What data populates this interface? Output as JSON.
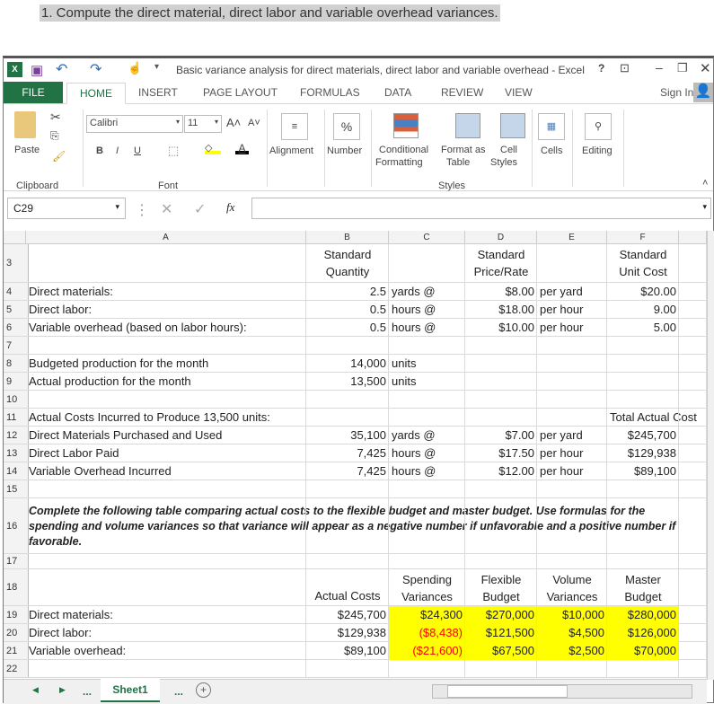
{
  "question": "1. Compute the direct material, direct labor and variable overhead variances.",
  "window": {
    "title": "Basic variance analysis for direct materials, direct labor and variable overhead - Excel",
    "help": "?",
    "sign_in": "Sign In"
  },
  "tabs": [
    "FILE",
    "HOME",
    "INSERT",
    "PAGE LAYOUT",
    "FORMULAS",
    "DATA",
    "REVIEW",
    "VIEW"
  ],
  "ribbon": {
    "paste": "Paste",
    "font_name": "Calibri",
    "font_size": "11",
    "bold": "B",
    "italic": "I",
    "underline": "U",
    "alignment": "Alignment",
    "number": "Number",
    "percent": "%",
    "conditional": "Conditional",
    "formatting": "Formatting",
    "format_as": "Format as",
    "table": "Table",
    "cell": "Cell",
    "styles_btn": "Styles",
    "cells": "Cells",
    "editing": "Editing",
    "groups": {
      "clipboard": "Clipboard",
      "font": "Font",
      "styles": "Styles"
    }
  },
  "formula_bar": {
    "name_box": "C29",
    "fx": "fx",
    "value": ""
  },
  "columns": [
    "A",
    "B",
    "C",
    "D",
    "E",
    "F"
  ],
  "rows": [
    {
      "n": "3",
      "cells": [
        {
          "c": "B",
          "t": "Standard\nQuantity",
          "a": "c"
        },
        {
          "c": "D",
          "t": "Standard\nPrice/Rate",
          "a": "c"
        },
        {
          "c": "F",
          "t": "Standard\nUnit Cost",
          "a": "c"
        }
      ]
    },
    {
      "n": "4",
      "cells": [
        {
          "c": "A",
          "t": "Direct materials:"
        },
        {
          "c": "B",
          "t": "2.5",
          "a": "r"
        },
        {
          "c": "C",
          "t": "yards @"
        },
        {
          "c": "D",
          "t": "$8.00",
          "a": "r"
        },
        {
          "c": "E",
          "t": "per yard"
        },
        {
          "c": "F",
          "t": "$20.00",
          "a": "r"
        }
      ]
    },
    {
      "n": "5",
      "cells": [
        {
          "c": "A",
          "t": "Direct labor:"
        },
        {
          "c": "B",
          "t": "0.5",
          "a": "r"
        },
        {
          "c": "C",
          "t": "hours @"
        },
        {
          "c": "D",
          "t": "$18.00",
          "a": "r"
        },
        {
          "c": "E",
          "t": "per hour"
        },
        {
          "c": "F",
          "t": "9.00",
          "a": "r"
        }
      ]
    },
    {
      "n": "6",
      "cells": [
        {
          "c": "A",
          "t": "Variable overhead (based on labor hours):"
        },
        {
          "c": "B",
          "t": "0.5",
          "a": "r"
        },
        {
          "c": "C",
          "t": "hours @"
        },
        {
          "c": "D",
          "t": "$10.00",
          "a": "r"
        },
        {
          "c": "E",
          "t": "per hour"
        },
        {
          "c": "F",
          "t": "5.00",
          "a": "r"
        }
      ]
    },
    {
      "n": "7",
      "cells": []
    },
    {
      "n": "8",
      "cells": [
        {
          "c": "A",
          "t": "Budgeted production for the month"
        },
        {
          "c": "B",
          "t": "14,000",
          "a": "r"
        },
        {
          "c": "C",
          "t": "units"
        }
      ]
    },
    {
      "n": "9",
      "cells": [
        {
          "c": "A",
          "t": "Actual production for the month"
        },
        {
          "c": "B",
          "t": "13,500",
          "a": "r"
        },
        {
          "c": "C",
          "t": "units"
        }
      ]
    },
    {
      "n": "10",
      "cells": []
    },
    {
      "n": "11",
      "cells": [
        {
          "c": "A",
          "t": "Actual Costs Incurred to Produce 13,500 units:"
        },
        {
          "c": "F",
          "t": "Total Actual Cost"
        }
      ]
    },
    {
      "n": "12",
      "cells": [
        {
          "c": "A",
          "t": "Direct Materials Purchased and Used"
        },
        {
          "c": "B",
          "t": "35,100",
          "a": "r"
        },
        {
          "c": "C",
          "t": "yards @"
        },
        {
          "c": "D",
          "t": "$7.00",
          "a": "r"
        },
        {
          "c": "E",
          "t": "per yard"
        },
        {
          "c": "F",
          "t": "$245,700",
          "a": "r"
        }
      ]
    },
    {
      "n": "13",
      "cells": [
        {
          "c": "A",
          "t": "Direct Labor Paid"
        },
        {
          "c": "B",
          "t": "7,425",
          "a": "r"
        },
        {
          "c": "C",
          "t": "hours @"
        },
        {
          "c": "D",
          "t": "$17.50",
          "a": "r"
        },
        {
          "c": "E",
          "t": "per hour"
        },
        {
          "c": "F",
          "t": "$129,938",
          "a": "r"
        }
      ]
    },
    {
      "n": "14",
      "cells": [
        {
          "c": "A",
          "t": "Variable Overhead Incurred"
        },
        {
          "c": "B",
          "t": "7,425",
          "a": "r"
        },
        {
          "c": "C",
          "t": "hours @"
        },
        {
          "c": "D",
          "t": "$12.00",
          "a": "r"
        },
        {
          "c": "E",
          "t": "per hour"
        },
        {
          "c": "F",
          "t": "$89,100",
          "a": "r"
        }
      ]
    },
    {
      "n": "15",
      "cells": []
    },
    {
      "n": "16",
      "cells": [
        {
          "c": "A",
          "t": "Complete the following table comparing actual costs to the flexible budget and master budget.  Use formulas for the spending and volume variances so that variance will appear as a negative number if unfavorable and a positive number if favorable.",
          "a": "wrap"
        }
      ]
    },
    {
      "n": "17",
      "cells": []
    },
    {
      "n": "18",
      "cells": [
        {
          "c": "B",
          "t": "Actual Costs",
          "a": "cb"
        },
        {
          "c": "C",
          "t": "Spending\nVariances",
          "a": "c"
        },
        {
          "c": "D",
          "t": "Flexible\nBudget",
          "a": "c"
        },
        {
          "c": "E",
          "t": "Volume\nVariances",
          "a": "c"
        },
        {
          "c": "F",
          "t": "Master\nBudget",
          "a": "c"
        }
      ]
    },
    {
      "n": "19",
      "cells": [
        {
          "c": "A",
          "t": "Direct materials:"
        },
        {
          "c": "B",
          "t": "$245,700",
          "a": "r"
        },
        {
          "c": "C",
          "t": "$24,300",
          "a": "r",
          "y": 1
        },
        {
          "c": "D",
          "t": "$270,000",
          "a": "r",
          "y": 1
        },
        {
          "c": "E",
          "t": "$10,000",
          "a": "r",
          "y": 1
        },
        {
          "c": "F",
          "t": "$280,000",
          "a": "r",
          "y": 1
        }
      ]
    },
    {
      "n": "20",
      "cells": [
        {
          "c": "A",
          "t": "Direct labor:"
        },
        {
          "c": "B",
          "t": "$129,938",
          "a": "r"
        },
        {
          "c": "C",
          "t": "($8,438)",
          "a": "r",
          "y": 1,
          "neg": 1
        },
        {
          "c": "D",
          "t": "$121,500",
          "a": "r",
          "y": 1
        },
        {
          "c": "E",
          "t": "$4,500",
          "a": "r",
          "y": 1
        },
        {
          "c": "F",
          "t": "$126,000",
          "a": "r",
          "y": 1
        }
      ]
    },
    {
      "n": "21",
      "cells": [
        {
          "c": "A",
          "t": "Variable overhead:"
        },
        {
          "c": "B",
          "t": "$89,100",
          "a": "r"
        },
        {
          "c": "C",
          "t": "($21,600)",
          "a": "r",
          "y": 1,
          "neg": 1
        },
        {
          "c": "D",
          "t": "$67,500",
          "a": "r",
          "y": 1
        },
        {
          "c": "E",
          "t": "$2,500",
          "a": "r",
          "y": 1
        },
        {
          "c": "F",
          "t": "$70,000",
          "a": "r",
          "y": 1
        }
      ]
    },
    {
      "n": "22",
      "cells": []
    }
  ],
  "colors": {
    "highlight": "#ffff00",
    "negative": "#ff0000",
    "excel_green": "#217346"
  },
  "sheet_tabs": {
    "more_left": "...",
    "active": "Sheet1",
    "more_right": "...",
    "add": "+"
  }
}
